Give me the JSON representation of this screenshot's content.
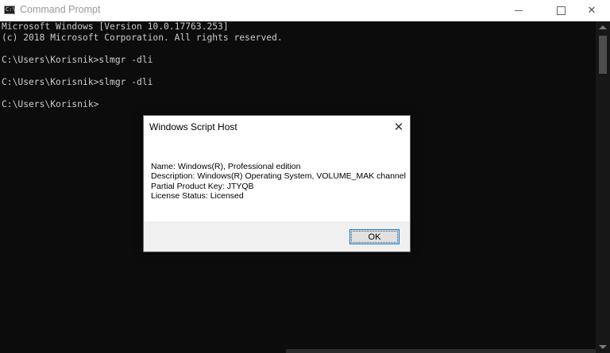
{
  "window": {
    "title": "Command Prompt",
    "app_icon_glyph": "C:\\",
    "minimize": "minimize",
    "maximize": "maximize",
    "close": "✕"
  },
  "console": {
    "lines": [
      "Microsoft Windows [Version 10.0.17763.253]",
      "(c) 2018 Microsoft Corporation. All rights reserved.",
      "",
      "C:\\Users\\Korisnik>slmgr -dli",
      "",
      "C:\\Users\\Korisnik>slmgr -dli",
      "",
      "C:\\Users\\Korisnik>"
    ]
  },
  "dialog": {
    "title": "Windows Script Host",
    "close": "✕",
    "lines": [
      "Name: Windows(R), Professional edition",
      "Description: Windows(R) Operating System, VOLUME_MAK channel",
      "Partial Product Key: JTYQB",
      "License Status: Licensed"
    ],
    "ok_label": "OK"
  },
  "colors": {
    "console_background": "#0c0c0c",
    "console_text": "#cccccc",
    "titlebar_background": "#ffffff",
    "dialog_footer": "#f0f0f0",
    "focus_border": "#0078d7"
  }
}
